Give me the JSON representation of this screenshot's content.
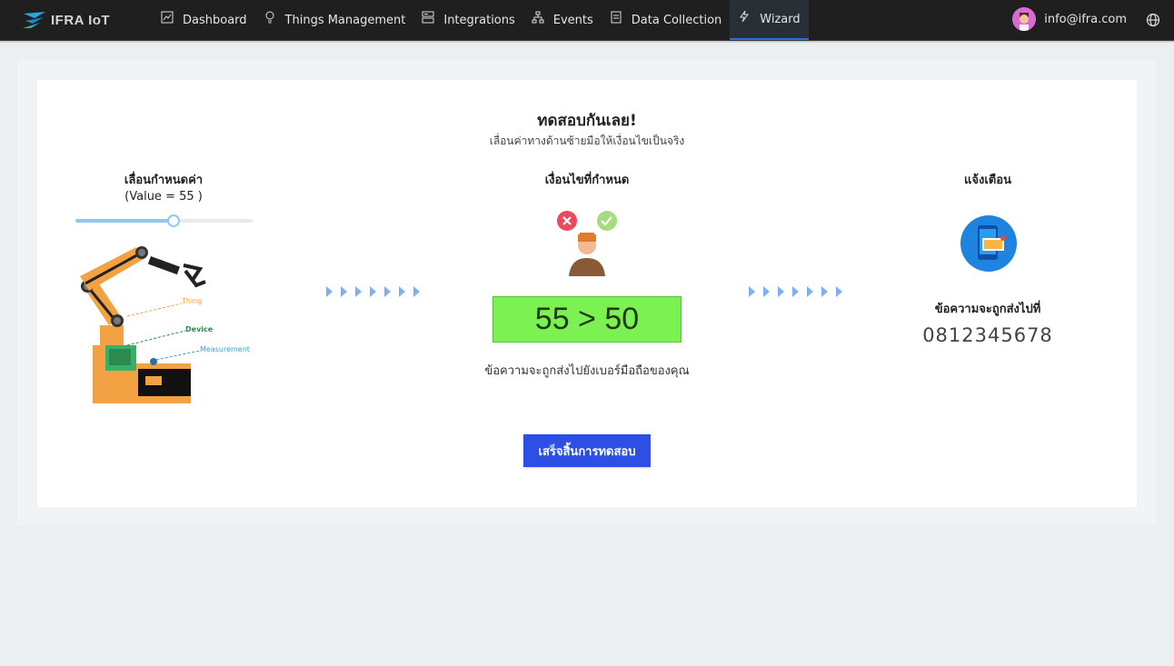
{
  "brand": {
    "name": "IFRA IoT"
  },
  "nav": {
    "items": [
      {
        "label": "Dashboard",
        "icon": "chart-icon"
      },
      {
        "label": "Things Management",
        "icon": "bulb-icon"
      },
      {
        "label": "Integrations",
        "icon": "server-icon"
      },
      {
        "label": "Events",
        "icon": "network-icon"
      },
      {
        "label": "Data Collection",
        "icon": "document-icon"
      },
      {
        "label": "Wizard",
        "icon": "lightning-icon",
        "active": true
      }
    ]
  },
  "user": {
    "email": "info@ifra.com"
  },
  "main": {
    "title": "ทดสอบกันเลย!",
    "subtitle": "เลื่อนค่าทางด้านซ้ายมือให้เงื่อนไขเป็นจริง",
    "left": {
      "heading": "เลื่อนกำหนดค่า",
      "value_text": "(Value = 55 )",
      "slider_value": 55,
      "labels": {
        "thing": "Thing",
        "device": "Device",
        "measurement": "Measurement"
      }
    },
    "middle": {
      "heading": "เงื่อนไขที่กำหนด",
      "condition": "55 > 50",
      "caption": "ข้อความจะถูกส่งไปยังเบอร์มือถือของคุณ"
    },
    "right": {
      "heading": "แจ้งเตือน",
      "caption": "ข้อความจะถูกส่งไปที่",
      "phone": "0812345678"
    },
    "finish_button": "เสร็จสิ้นการทดสอบ"
  },
  "colors": {
    "accent": "#2d4fe6",
    "condition_bg": "#7cf152",
    "slider": "#8ec9f3",
    "arrow": "#7fb0f5"
  }
}
